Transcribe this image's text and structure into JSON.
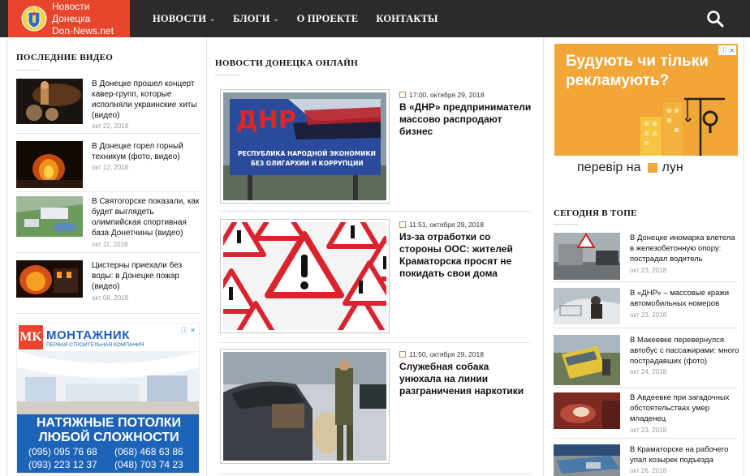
{
  "site": {
    "logo_line1": "Новости Донецка",
    "logo_line2": "Don-News.net",
    "nav": [
      {
        "label": "НОВОСТИ",
        "has_dropdown": true
      },
      {
        "label": "БЛОГИ",
        "has_dropdown": true
      },
      {
        "label": "О ПРОЕКТЕ",
        "has_dropdown": false
      },
      {
        "label": "КОНТАКТЫ",
        "has_dropdown": false
      }
    ],
    "search_icon": "search-icon",
    "colors": {
      "topbar": "#2b2b2b",
      "logo_bg": "#e8452c",
      "ad_right_bg": "#f2a637"
    }
  },
  "videos": {
    "title": "ПОСЛЕДНИЕ ВИДЕО",
    "items": [
      {
        "title": "В Донецке прошел концерт кавер-групп, которые исполняли украинские хиты (видео)",
        "date": "окт 22, 2018"
      },
      {
        "title": "В Донецке горел горный техникум (фото, видео)",
        "date": "окт 12, 2018"
      },
      {
        "title": "В Святогорске показали, как будет выглядеть олимпийская спортивная база Донетчины (видео)",
        "date": "окт 11, 2018"
      },
      {
        "title": "Цистерны приехали без воды: в Донецке пожар (видео)",
        "date": "окт 08, 2018"
      }
    ]
  },
  "ad_left": {
    "brand": "МОНТАЖНИК",
    "tagline": "ПЕРВАЯ СТРОИТЕЛЬНАЯ КОМПАНИЯ",
    "headline1": "НАТЯЖНЫЕ ПОТОЛКИ",
    "headline2": "ЛЮБОЙ СЛОЖНОСТИ",
    "phones": [
      "(095) 095 76 68",
      "(068) 468 63 86",
      "(093) 223 12 37",
      "(048) 703 74 23"
    ]
  },
  "ad_right": {
    "headline": "Будують чи тільки рекламують?",
    "cta": "перевір на",
    "brand": "лун"
  },
  "news": {
    "title": "НОВОСТИ ДОНЕЦКА ОНЛАЙН",
    "items": [
      {
        "meta": "17:00, октября 29, 2018",
        "title": "В «ДНР» предприниматели массово распродают бизнес",
        "image_text": [
          "ДНР",
          "РЕСПУБЛИКА НАРОДНОЙ ЭКОНОМИКИ",
          "БЕЗ ОЛИГАРХИИ И КОРРУПЦИИ"
        ]
      },
      {
        "meta": "11:51, октября 29, 2018",
        "title": "Из-за отработки со стороны ООС: жителей Краматорска просят не покидать свои дома"
      },
      {
        "meta": "11:50, октября 29, 2018",
        "title": "Служебная собака унюхала на линии разграничения наркотики"
      }
    ]
  },
  "top": {
    "title": "СЕГОДНЯ В ТОПЕ",
    "items": [
      {
        "title": "В Донецке иномарка влетела в железобетонную опору: пострадал водитель",
        "date": "окт 23, 2018"
      },
      {
        "title": "В «ДНР» – массовые кражи автомобильных номеров",
        "date": "окт 23, 2018"
      },
      {
        "title": "В Макеевке перевернулся автобус с пассажирами: много пострадавших (фото)",
        "date": "окт 24, 2018"
      },
      {
        "title": "В Авдеевке при загадочных обстоятельствах умер младенец",
        "date": "окт 23, 2018"
      },
      {
        "title": "В Краматорске на рабочего упал козырек подъезда",
        "date": "окт 26, 2018"
      }
    ]
  }
}
